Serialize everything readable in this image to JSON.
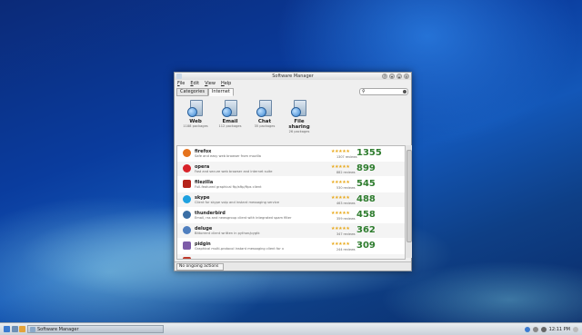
{
  "window": {
    "title": "Software Manager"
  },
  "menu": [
    "File",
    "Edit",
    "View",
    "Help"
  ],
  "tabs": [
    "Categories",
    "Internet"
  ],
  "search": {
    "placeholder": ""
  },
  "categories": [
    {
      "name": "Web",
      "count": "1188 packages",
      "icon": "web-globe-icon"
    },
    {
      "name": "Email",
      "count": "112 packages",
      "icon": "email-icon"
    },
    {
      "name": "Chat",
      "count": "35 packages",
      "icon": "chat-icon"
    },
    {
      "name": "File sharing",
      "count": "26 packages",
      "icon": "file-sharing-icon"
    }
  ],
  "apps": [
    {
      "name": "firefox",
      "desc": "Safe and easy web browser from mozilla",
      "reviews": "1307 reviews",
      "score": "1355",
      "stars": "★★★★★",
      "color": "#e5731d"
    },
    {
      "name": "opera",
      "desc": "Fast and secure web browser and internet suite",
      "reviews": "882 reviews",
      "score": "899",
      "stars": "★★★★★",
      "color": "#d8232a"
    },
    {
      "name": "filezilla",
      "desc": "Full-featured graphical ftp/sftp/ftps client",
      "reviews": "530 reviews",
      "score": "545",
      "stars": "★★★★★",
      "color": "#b5241b"
    },
    {
      "name": "skype",
      "desc": "Client for skype voip and instant messaging service",
      "reviews": "463 reviews",
      "score": "488",
      "stars": "★★★★★",
      "color": "#1ea1e0"
    },
    {
      "name": "thunderbird",
      "desc": "Email, rss and newsgroup client with integrated spam filter",
      "reviews": "359 reviews",
      "score": "458",
      "stars": "★★★★★",
      "color": "#3a6ea5"
    },
    {
      "name": "deluge",
      "desc": "Bittorrent client written in python/pygtk",
      "reviews": "347 reviews",
      "score": "362",
      "stars": "★★★★★",
      "color": "#4f7fbf"
    },
    {
      "name": "pidgin",
      "desc": "Graphical multi-protocol instant messaging client for x",
      "reviews": "244 reviews",
      "score": "309",
      "stars": "★★★★★",
      "color": "#7d5ca8"
    }
  ],
  "status": {
    "label": "No ongoing actions"
  },
  "taskbar": {
    "task": "Software Manager",
    "clock": "12:11 PM"
  }
}
